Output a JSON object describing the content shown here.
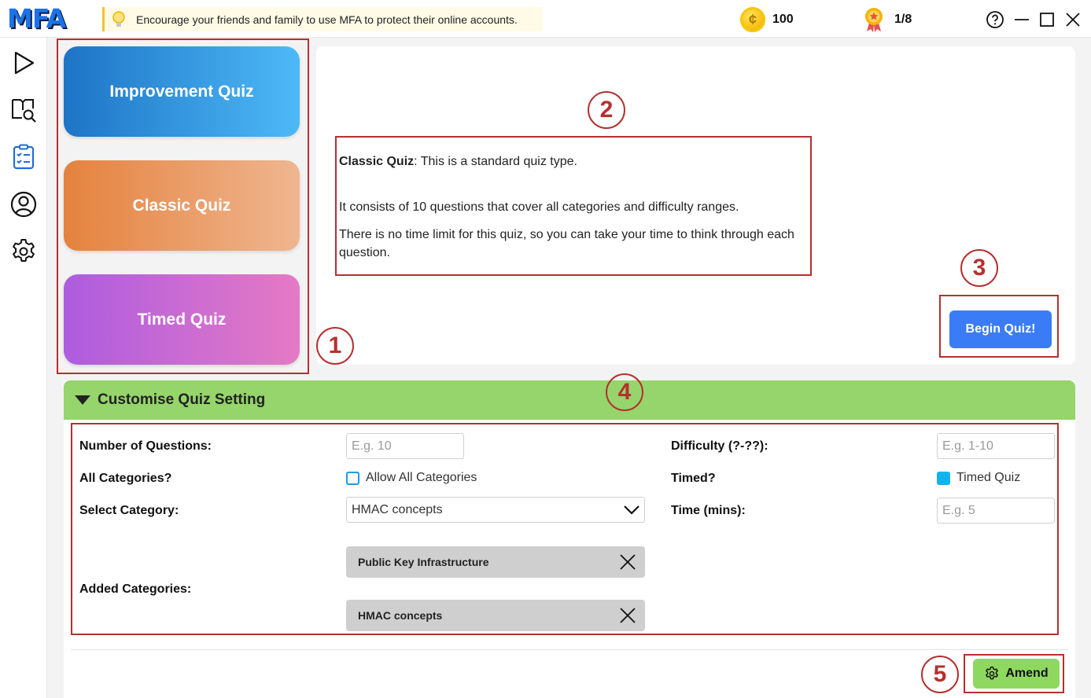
{
  "app": {
    "logo_text": "MFA",
    "tip_text": "Encourage your friends and family to use MFA to protect their online accounts.",
    "coins": "100",
    "achievements": "1/8"
  },
  "nav": {
    "items": [
      {
        "icon": "play-icon"
      },
      {
        "icon": "book-search-icon"
      },
      {
        "icon": "checklist-icon"
      },
      {
        "icon": "user-circle-icon"
      },
      {
        "icon": "gear-icon"
      }
    ]
  },
  "quiz_types": {
    "improvement": "Improvement Quiz",
    "classic": "Classic Quiz",
    "timed": "Timed Quiz"
  },
  "description": {
    "title": "Classic Quiz",
    "intro": ": This is a standard quiz type.",
    "para1": "It consists of 10 questions that cover all categories and difficulty ranges.",
    "para2": "There is no time limit for this quiz, so you can take your time to think through each question."
  },
  "begin_label": "Begin Quiz!",
  "settings": {
    "title": "Customise Quiz Setting",
    "num_questions_label": "Number of Questions:",
    "num_questions_placeholder": "E.g. 10",
    "difficulty_label": "Difficulty (?-??):",
    "difficulty_placeholder": "E.g. 1-10",
    "all_categories_label": "All Categories?",
    "allow_all_label": "Allow All Categories",
    "allow_all_checked": false,
    "timed_label": "Timed?",
    "timed_quiz_label": "Timed Quiz",
    "timed_checked": true,
    "select_category_label": "Select Category:",
    "selected_category": "HMAC concepts",
    "time_label": "Time (mins):",
    "time_placeholder": "E.g. 5",
    "added_categories_label": "Added Categories:",
    "added_categories": [
      "Public Key Infrastructure",
      "HMAC concepts"
    ],
    "amend_label": "Amend"
  },
  "annotations": [
    "1",
    "2",
    "3",
    "4",
    "5"
  ],
  "colors": {
    "accent_blue": "#3a7cf5",
    "settings_green": "#95d56b",
    "annotation_red": "#b5302f"
  }
}
